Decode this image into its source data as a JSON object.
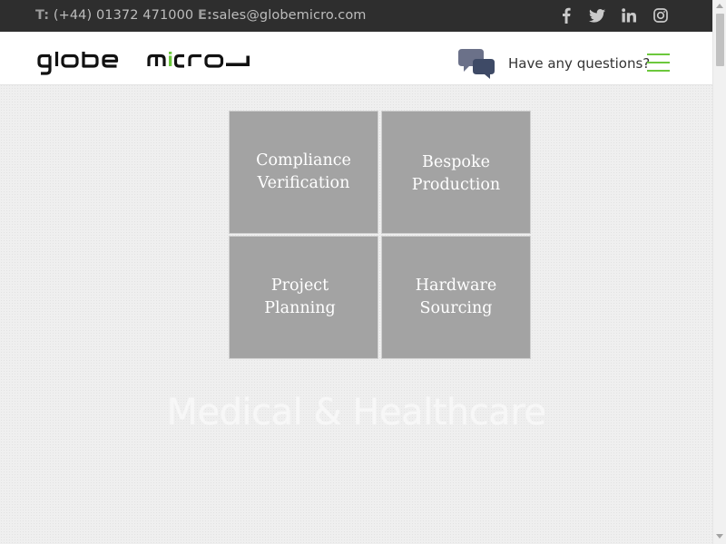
{
  "topbar": {
    "phone_prefix": "T:",
    "phone": "(+44) 01372 471000",
    "email_prefix": "E:",
    "email": "sales@globemicro.com",
    "social": [
      "facebook-icon",
      "twitter-icon",
      "linkedin-icon",
      "instagram-icon"
    ]
  },
  "header": {
    "logo_text": "globe micro",
    "questions": "Have any questions?",
    "accent_color": "#6cc83c"
  },
  "tiles": [
    {
      "line1": "Compliance",
      "line2": "Verification"
    },
    {
      "line1": "Bespoke",
      "line2": "Production"
    },
    {
      "line1": "Project",
      "line2": "Planning"
    },
    {
      "line1": "Hardware",
      "line2": "Sourcing"
    }
  ],
  "section": {
    "title": "Medical & Healthcare"
  }
}
